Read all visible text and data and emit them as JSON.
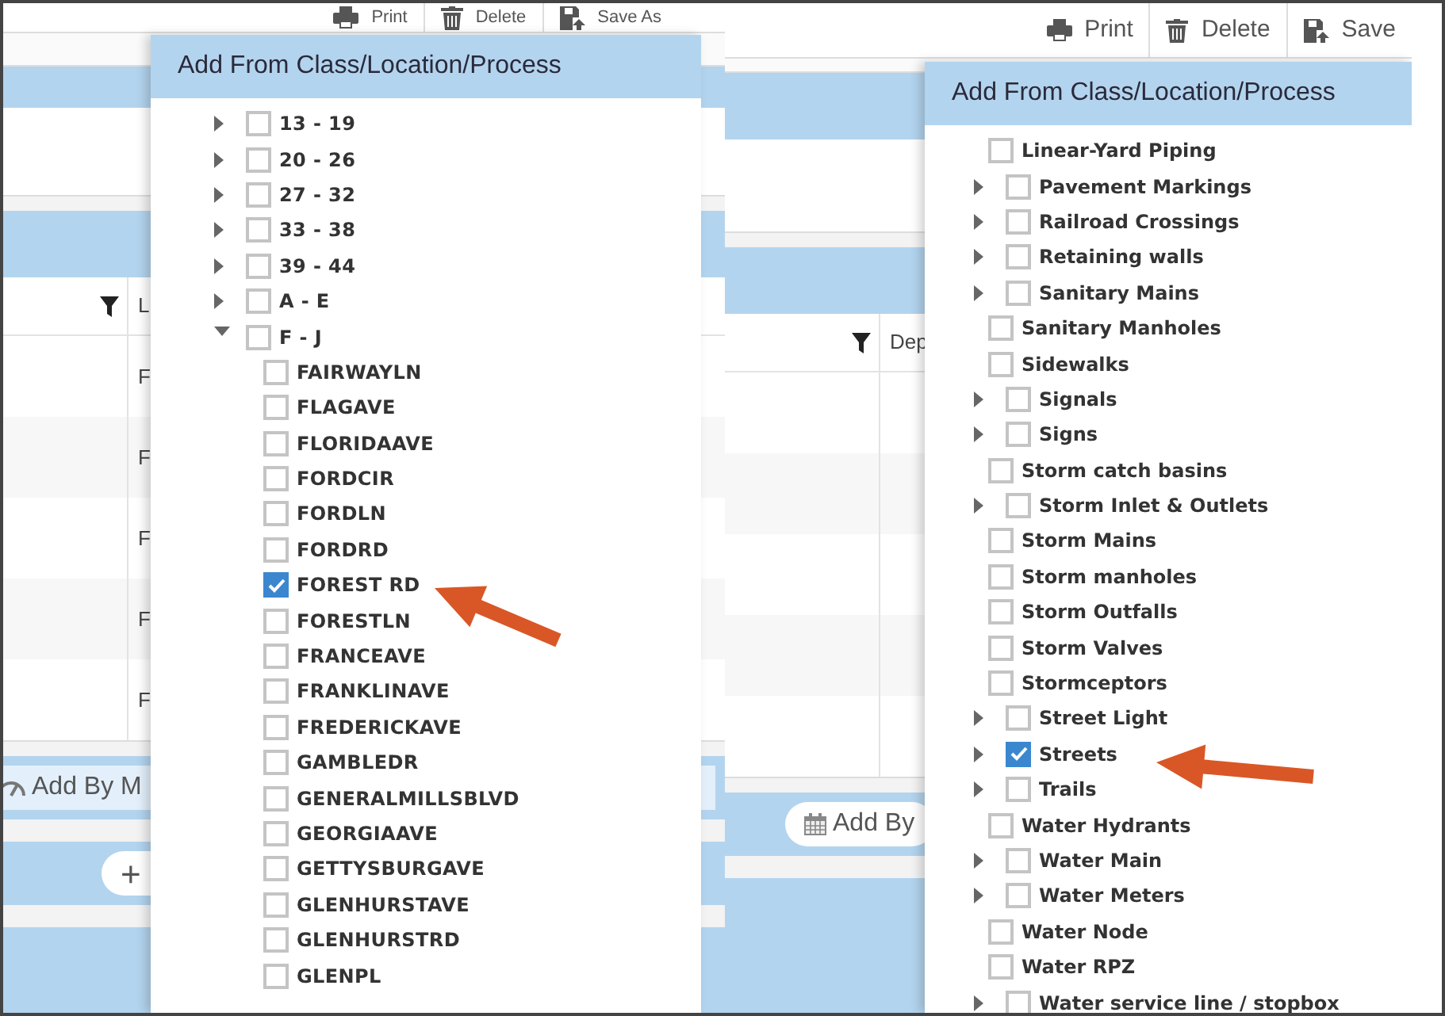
{
  "panels": [
    {
      "toolbar": [
        {
          "kind": "print",
          "label": "Print"
        },
        {
          "kind": "delete",
          "label": "Delete"
        },
        {
          "kind": "save",
          "label": "Save As"
        }
      ],
      "grid": {
        "header": "L",
        "cells": [
          "F",
          "F",
          "F",
          "F",
          "F"
        ]
      },
      "buttons": [
        {
          "kind": "gauge",
          "label": "Add By M"
        },
        {
          "kind": "plus",
          "label": "+"
        }
      ],
      "dialog": {
        "title": "Add From Class/Location/Process",
        "tree": [
          {
            "label": "13 - 19",
            "checked": false,
            "expanded": false
          },
          {
            "label": "20 - 26",
            "checked": false,
            "expanded": false
          },
          {
            "label": "27 - 32",
            "checked": false,
            "expanded": false
          },
          {
            "label": "33 - 38",
            "checked": false,
            "expanded": false
          },
          {
            "label": "39 - 44",
            "checked": false,
            "expanded": false
          },
          {
            "label": "A - E",
            "checked": false,
            "expanded": false
          },
          {
            "label": "F - J",
            "checked": false,
            "expanded": true,
            "children": [
              {
                "label": "FAIRWAYLN",
                "checked": false
              },
              {
                "label": "FLAGAVE",
                "checked": false
              },
              {
                "label": "FLORIDAAVE",
                "checked": false
              },
              {
                "label": "FORDCIR",
                "checked": false
              },
              {
                "label": "FORDLN",
                "checked": false
              },
              {
                "label": "FORDRD",
                "checked": false
              },
              {
                "label": "FOREST RD",
                "checked": true
              },
              {
                "label": "FORESTLN",
                "checked": false
              },
              {
                "label": "FRANCEAVE",
                "checked": false
              },
              {
                "label": "FRANKLINAVE",
                "checked": false
              },
              {
                "label": "FREDERICKAVE",
                "checked": false
              },
              {
                "label": "GAMBLEDR",
                "checked": false
              },
              {
                "label": "GENERALMILLSBLVD",
                "checked": false
              },
              {
                "label": "GEORGIAAVE",
                "checked": false
              },
              {
                "label": "GETTYSBURGAVE",
                "checked": false
              },
              {
                "label": "GLENHURSTAVE",
                "checked": false
              },
              {
                "label": "GLENHURSTRD",
                "checked": false
              },
              {
                "label": "GLENPL",
                "checked": false
              }
            ]
          }
        ]
      }
    },
    {
      "toolbar": [
        {
          "kind": "print",
          "label": "Print"
        },
        {
          "kind": "delete",
          "label": "Delete"
        },
        {
          "kind": "save",
          "label": "Save"
        }
      ],
      "grid": {
        "header": "Dep"
      },
      "buttons": [
        {
          "kind": "calendar",
          "label": "Add By"
        }
      ],
      "dialog": {
        "title": "Add From Class/Location/Process",
        "tree": [
          {
            "label": "Linear-Yard Piping",
            "checked": false
          },
          {
            "label": "Pavement Markings",
            "checked": false,
            "expanded": false
          },
          {
            "label": "Railroad Crossings",
            "checked": false,
            "expanded": false
          },
          {
            "label": "Retaining walls",
            "checked": false,
            "expanded": false
          },
          {
            "label": "Sanitary Mains",
            "checked": false,
            "expanded": false
          },
          {
            "label": "Sanitary Manholes",
            "checked": false
          },
          {
            "label": "Sidewalks",
            "checked": false
          },
          {
            "label": "Signals",
            "checked": false,
            "expanded": false
          },
          {
            "label": "Signs",
            "checked": false,
            "expanded": false
          },
          {
            "label": "Storm catch basins",
            "checked": false
          },
          {
            "label": "Storm Inlet & Outlets",
            "checked": false,
            "expanded": false
          },
          {
            "label": "Storm Mains",
            "checked": false
          },
          {
            "label": "Storm manholes",
            "checked": false
          },
          {
            "label": "Storm Outfalls",
            "checked": false
          },
          {
            "label": "Storm Valves",
            "checked": false
          },
          {
            "label": "Stormceptors",
            "checked": false
          },
          {
            "label": "Street Light",
            "checked": false,
            "expanded": false
          },
          {
            "label": "Streets",
            "checked": true,
            "expanded": false
          },
          {
            "label": "Trails",
            "checked": false,
            "expanded": false
          },
          {
            "label": "Water Hydrants",
            "checked": false
          },
          {
            "label": "Water Main",
            "checked": false,
            "expanded": false
          },
          {
            "label": "Water Meters",
            "checked": false,
            "expanded": false
          },
          {
            "label": "Water Node",
            "checked": false
          },
          {
            "label": "Water RPZ",
            "checked": false
          },
          {
            "label": "Water service line / stopbox",
            "checked": false,
            "expanded": false
          }
        ]
      }
    }
  ]
}
